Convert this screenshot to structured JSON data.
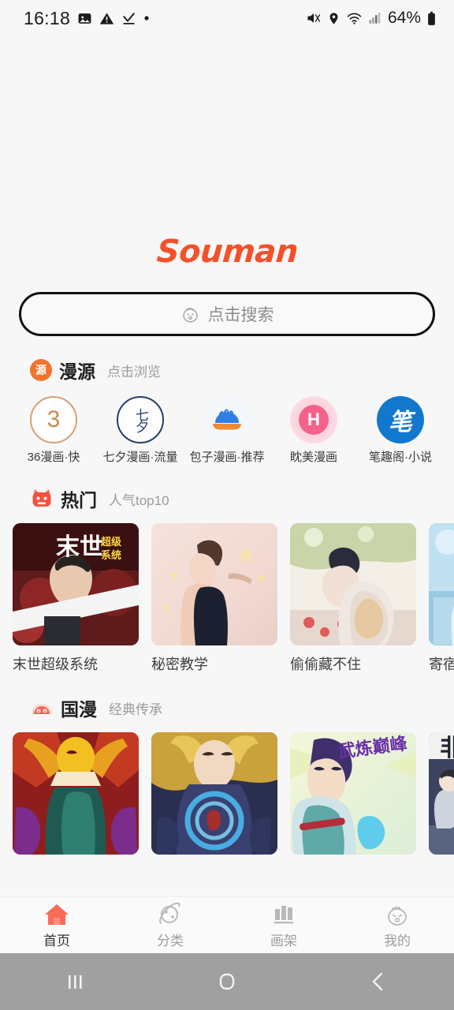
{
  "status_bar": {
    "time": "16:18",
    "battery_text": "64%",
    "left_icons": [
      "image-icon",
      "warning-icon",
      "check-download-icon",
      "dot-icon"
    ],
    "right_icons": [
      "mute-icon",
      "location-icon",
      "wifi-icon",
      "signal-icon",
      "battery-icon"
    ]
  },
  "app": {
    "logo_text": "Souman",
    "logo_color": "#f4502a"
  },
  "search": {
    "placeholder": "点击搜索",
    "icon": "mascot-face-icon"
  },
  "sections": [
    {
      "id": "source",
      "badge_text": "源",
      "badge_color": "#f4732a",
      "title": "漫源",
      "subtitle": "点击浏览"
    },
    {
      "id": "hot",
      "badge_icon": "cat-face-icon",
      "badge_color": "#f4503f",
      "title": "热门",
      "subtitle": "人气top10"
    },
    {
      "id": "guoman",
      "badge_icon": "bun-face-icon",
      "badge_color": "#f4645a",
      "title": "国漫",
      "subtitle": "经典传承"
    }
  ],
  "sources": [
    {
      "label": "36漫画·快",
      "glyph": "3",
      "icon": "source-36-icon"
    },
    {
      "label": "七夕漫画·流量",
      "glyph": "七夕",
      "icon": "source-qixi-icon"
    },
    {
      "label": "包子漫画·推荐",
      "glyph": "",
      "icon": "source-baozi-icon"
    },
    {
      "label": "眈美漫画",
      "glyph": "H",
      "icon": "source-danmei-icon"
    },
    {
      "label": "笔趣阁·小说",
      "glyph": "笔",
      "icon": "source-biquge-icon"
    }
  ],
  "hot_comics": [
    {
      "title": "末世超级系统",
      "cover_text": "末世",
      "cover_sub": "超级系统"
    },
    {
      "title": "秘密教学",
      "cover_text": "",
      "cover_sub": ""
    },
    {
      "title": "偷偷藏不住",
      "cover_text": "",
      "cover_sub": ""
    },
    {
      "title": "寄宿日记",
      "cover_text": "",
      "cover_sub": ""
    }
  ],
  "guoman_comics": [
    {
      "title": "",
      "cover_text": "",
      "cover_sub": ""
    },
    {
      "title": "",
      "cover_text": "",
      "cover_sub": ""
    },
    {
      "title": "",
      "cover_text": "武炼巅峰",
      "cover_sub": ""
    },
    {
      "title": "",
      "cover_text": "非",
      "cover_sub": ""
    }
  ],
  "tabbar": {
    "items": [
      {
        "label": "首页",
        "icon": "home-icon",
        "active": true
      },
      {
        "label": "分类",
        "icon": "planet-icon",
        "active": false
      },
      {
        "label": "画架",
        "icon": "bars-icon",
        "active": false
      },
      {
        "label": "我的",
        "icon": "mascot-face-icon",
        "active": false
      }
    ],
    "active_color": "#fa6a5a"
  },
  "android_nav": {
    "recents": "recents-icon",
    "home": "home-square-icon",
    "back": "back-chevron-icon"
  }
}
